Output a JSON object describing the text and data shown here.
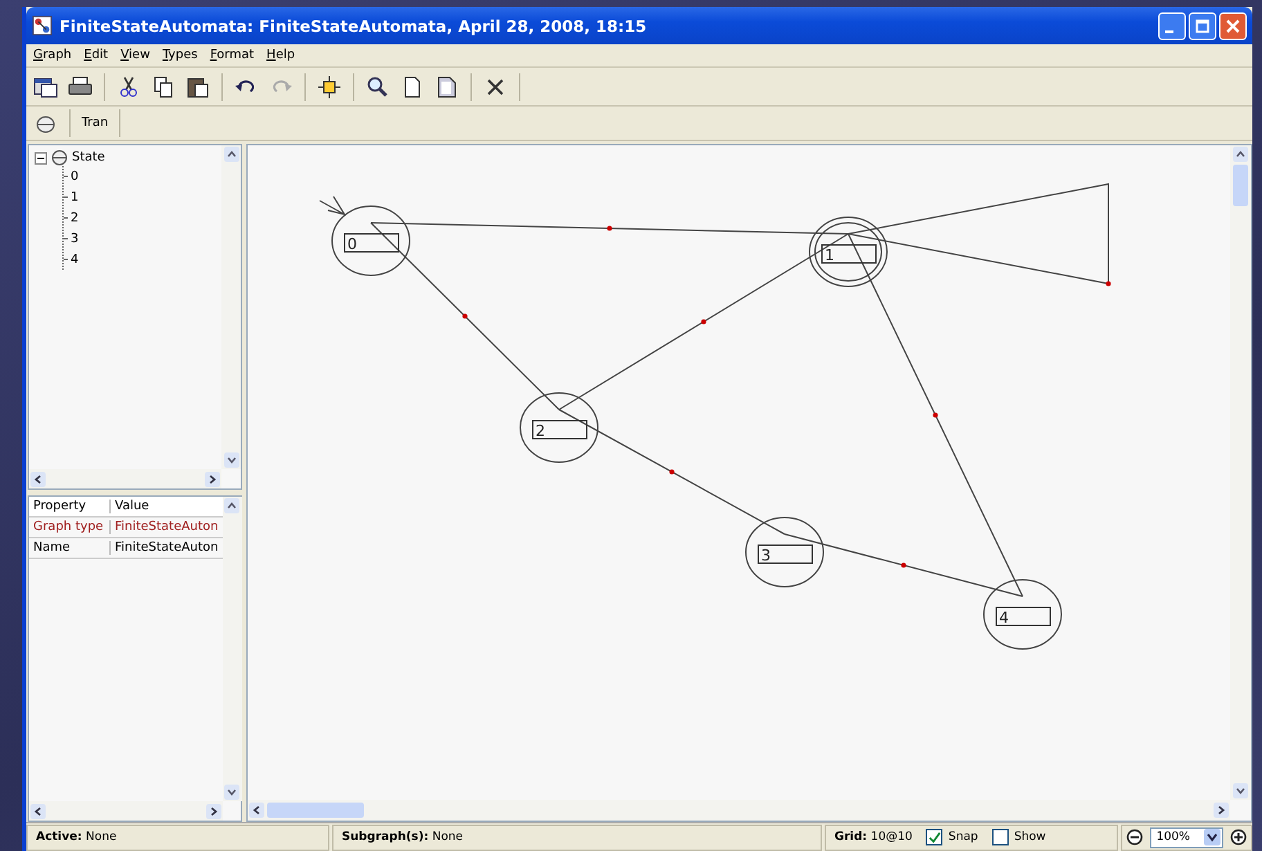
{
  "window": {
    "title": "FiniteStateAutomata: FiniteStateAutomata, April 28, 2008, 18:15"
  },
  "menu": [
    {
      "label": "Graph"
    },
    {
      "label": "Edit"
    },
    {
      "label": "View"
    },
    {
      "label": "Types"
    },
    {
      "label": "Format"
    },
    {
      "label": "Help"
    }
  ],
  "toolbar": {
    "redo_disabled": true
  },
  "palette": {
    "button": "Tran"
  },
  "tree": {
    "label": "State",
    "expanded": true,
    "children": [
      {
        "label": "0"
      },
      {
        "label": "1"
      },
      {
        "label": "2"
      },
      {
        "label": "3"
      },
      {
        "label": "4"
      }
    ]
  },
  "properties": {
    "columns": [
      "Property",
      "Value"
    ],
    "rows": [
      {
        "property": "Graph type",
        "value": "FiniteStateAuton",
        "highlighted": true
      },
      {
        "property": "Name",
        "value": "FiniteStateAuton",
        "highlighted": false
      }
    ]
  },
  "graph": {
    "states": [
      {
        "label": "0",
        "initial": true,
        "accepting": false
      },
      {
        "label": "1",
        "initial": false,
        "accepting": true
      },
      {
        "label": "2",
        "initial": false,
        "accepting": false
      },
      {
        "label": "3",
        "initial": false,
        "accepting": false
      },
      {
        "label": "4",
        "initial": false,
        "accepting": false
      }
    ]
  },
  "status": {
    "active_label": "Active:",
    "active": "None",
    "subgraph_label": "Subgraph(s):",
    "subgraph": "None",
    "grid_label": "Grid:",
    "grid": "10@10",
    "snap": {
      "label": "Snap",
      "checked": true
    },
    "show": {
      "label": "Show",
      "checked": false
    },
    "zoom": "100%"
  }
}
